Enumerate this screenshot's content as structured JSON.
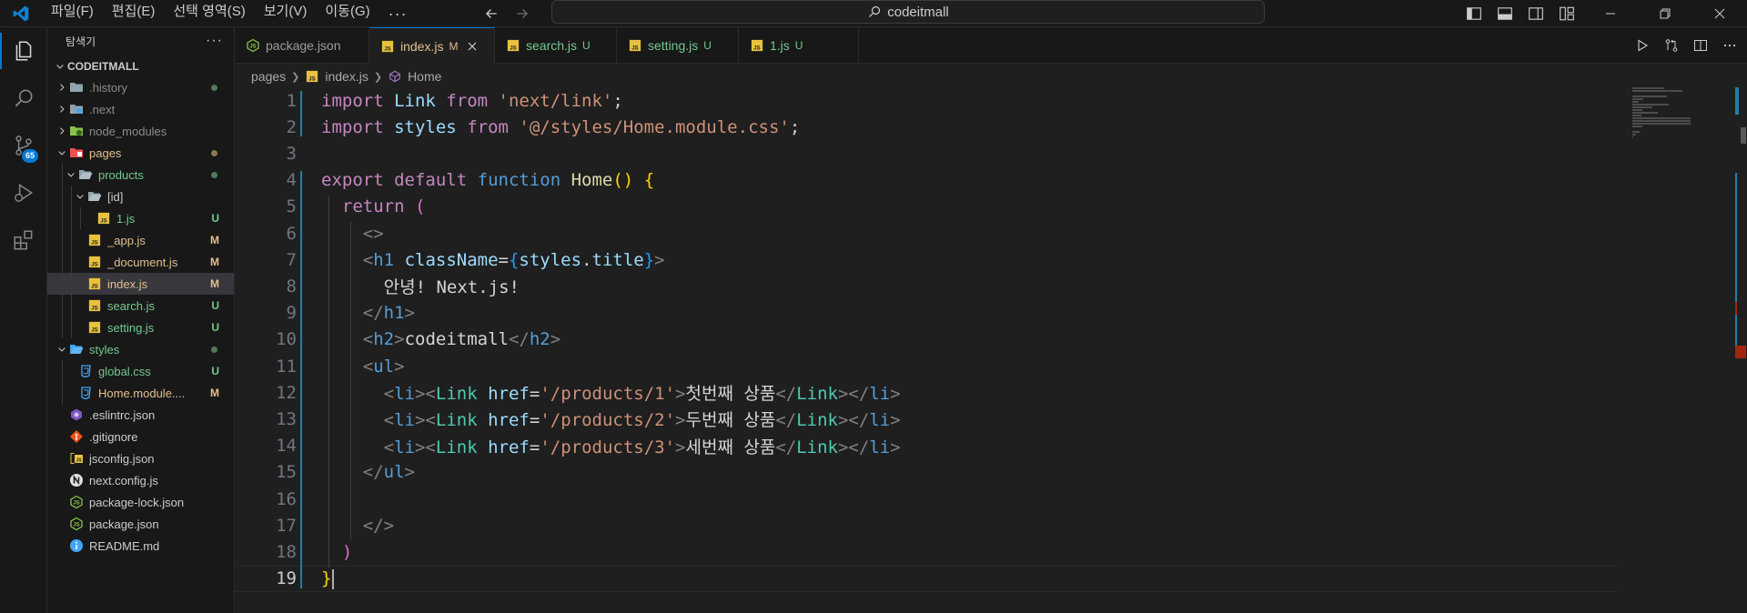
{
  "menubar": {
    "items": [
      "파일(F)",
      "편집(E)",
      "선택 영역(S)",
      "보기(V)",
      "이동(G)"
    ],
    "more": "···"
  },
  "command_center": {
    "label": "codeitmall"
  },
  "activitybar": {
    "items": [
      "explorer",
      "search",
      "source-control",
      "run-debug",
      "extensions"
    ],
    "scm_badge": "65"
  },
  "sidebar": {
    "title": "탐색기",
    "more": "···",
    "section": "CODEITMALL",
    "tree": [
      {
        "label": ".history",
        "depth": 0,
        "kind": "folder",
        "open": false,
        "color": "grey",
        "dot": "green"
      },
      {
        "label": ".next",
        "depth": 0,
        "kind": "folder-special",
        "open": false,
        "color": "grey",
        "dot": ""
      },
      {
        "label": "node_modules",
        "depth": 0,
        "kind": "folder-node",
        "open": false,
        "color": "grey",
        "dot": ""
      },
      {
        "label": "pages",
        "depth": 0,
        "kind": "folder-pages",
        "open": true,
        "color": "yellow",
        "dot": "yellow"
      },
      {
        "label": "products",
        "depth": 1,
        "kind": "folder-open",
        "open": true,
        "color": "green",
        "dot": "green"
      },
      {
        "label": "[id]",
        "depth": 2,
        "kind": "folder-open",
        "open": true,
        "color": "plain",
        "dot": ""
      },
      {
        "label": "1.js",
        "depth": 3,
        "kind": "js",
        "color": "green",
        "status": "U"
      },
      {
        "label": "_app.js",
        "depth": 2,
        "kind": "js",
        "color": "yellow",
        "status": "M"
      },
      {
        "label": "_document.js",
        "depth": 2,
        "kind": "js",
        "color": "yellow",
        "status": "M"
      },
      {
        "label": "index.js",
        "depth": 2,
        "kind": "js",
        "color": "yellow",
        "status": "M",
        "selected": true
      },
      {
        "label": "search.js",
        "depth": 2,
        "kind": "js",
        "color": "green",
        "status": "U"
      },
      {
        "label": "setting.js",
        "depth": 2,
        "kind": "js",
        "color": "green",
        "status": "U"
      },
      {
        "label": "styles",
        "depth": 0,
        "kind": "folder-open-blue",
        "open": true,
        "color": "green",
        "dot": "green"
      },
      {
        "label": "global.css",
        "depth": 1,
        "kind": "css",
        "color": "green",
        "status": "U"
      },
      {
        "label": "Home.module....",
        "depth": 1,
        "kind": "css",
        "color": "yellow",
        "status": "M"
      },
      {
        "label": ".eslintrc.json",
        "depth": 0,
        "kind": "eslint",
        "color": "plain"
      },
      {
        "label": ".gitignore",
        "depth": 0,
        "kind": "git",
        "color": "plain"
      },
      {
        "label": "jsconfig.json",
        "depth": 0,
        "kind": "jsconfig",
        "color": "plain"
      },
      {
        "label": "next.config.js",
        "depth": 0,
        "kind": "next",
        "color": "plain"
      },
      {
        "label": "package-lock.json",
        "depth": 0,
        "kind": "npm",
        "color": "plain"
      },
      {
        "label": "package.json",
        "depth": 0,
        "kind": "npm",
        "color": "plain"
      },
      {
        "label": "README.md",
        "depth": 0,
        "kind": "info",
        "color": "plain"
      }
    ]
  },
  "tabs": [
    {
      "label": "package.json",
      "icon": "npm",
      "status": "",
      "active": false
    },
    {
      "label": "index.js",
      "icon": "js",
      "status": "M",
      "active": true
    },
    {
      "label": "search.js",
      "icon": "js",
      "status": "U",
      "active": false
    },
    {
      "label": "setting.js",
      "icon": "js",
      "status": "U",
      "active": false
    },
    {
      "label": "1.js",
      "icon": "js",
      "status": "U",
      "active": false
    }
  ],
  "breadcrumb": [
    "pages",
    "index.js",
    "Home"
  ],
  "editor": {
    "active_line": 19,
    "lines": [
      [
        [
          "kw",
          "import"
        ],
        [
          "tx",
          " "
        ],
        [
          "vr",
          "Link"
        ],
        [
          "tx",
          " "
        ],
        [
          "kw",
          "from"
        ],
        [
          "tx",
          " "
        ],
        [
          "st",
          "'next/link'"
        ],
        [
          "tx",
          ";"
        ]
      ],
      [
        [
          "kw",
          "import"
        ],
        [
          "tx",
          " "
        ],
        [
          "vr",
          "styles"
        ],
        [
          "tx",
          " "
        ],
        [
          "kw",
          "from"
        ],
        [
          "tx",
          " "
        ],
        [
          "st",
          "'@/styles/Home.module.css'"
        ],
        [
          "tx",
          ";"
        ]
      ],
      [],
      [
        [
          "kw",
          "export"
        ],
        [
          "tx",
          " "
        ],
        [
          "kw",
          "default"
        ],
        [
          "tx",
          " "
        ],
        [
          "bl",
          "function"
        ],
        [
          "tx",
          " "
        ],
        [
          "fn",
          "Home"
        ],
        [
          "b1",
          "()"
        ],
        [
          "tx",
          " "
        ],
        [
          "b1",
          "{"
        ]
      ],
      [
        [
          "tx",
          "  "
        ],
        [
          "kw",
          "return"
        ],
        [
          "tx",
          " "
        ],
        [
          "b2",
          "("
        ]
      ],
      [
        [
          "tx",
          "    "
        ],
        [
          "pn",
          "<>"
        ]
      ],
      [
        [
          "tx",
          "    "
        ],
        [
          "pn",
          "<"
        ],
        [
          "tg",
          "h1"
        ],
        [
          "tx",
          " "
        ],
        [
          "at",
          "className"
        ],
        [
          "tx",
          "="
        ],
        [
          "b3",
          "{"
        ],
        [
          "vr",
          "styles"
        ],
        [
          "tx",
          "."
        ],
        [
          "vr",
          "title"
        ],
        [
          "b3",
          "}"
        ],
        [
          "pn",
          ">"
        ]
      ],
      [
        [
          "tx",
          "      안녕! Next.js!"
        ]
      ],
      [
        [
          "tx",
          "    "
        ],
        [
          "pn",
          "</"
        ],
        [
          "tg",
          "h1"
        ],
        [
          "pn",
          ">"
        ]
      ],
      [
        [
          "tx",
          "    "
        ],
        [
          "pn",
          "<"
        ],
        [
          "tg",
          "h2"
        ],
        [
          "pn",
          ">"
        ],
        [
          "tx",
          "codeitmall"
        ],
        [
          "pn",
          "</"
        ],
        [
          "tg",
          "h2"
        ],
        [
          "pn",
          ">"
        ]
      ],
      [
        [
          "tx",
          "    "
        ],
        [
          "pn",
          "<"
        ],
        [
          "tg",
          "ul"
        ],
        [
          "pn",
          ">"
        ]
      ],
      [
        [
          "tx",
          "      "
        ],
        [
          "pn",
          "<"
        ],
        [
          "tg",
          "li"
        ],
        [
          "pn",
          "><"
        ],
        [
          "cp",
          "Link"
        ],
        [
          "tx",
          " "
        ],
        [
          "at",
          "href"
        ],
        [
          "tx",
          "="
        ],
        [
          "st",
          "'/products/1'"
        ],
        [
          "pn",
          ">"
        ],
        [
          "tx",
          "첫번째 상품"
        ],
        [
          "pn",
          "</"
        ],
        [
          "cp",
          "Link"
        ],
        [
          "pn",
          "></"
        ],
        [
          "tg",
          "li"
        ],
        [
          "pn",
          ">"
        ]
      ],
      [
        [
          "tx",
          "      "
        ],
        [
          "pn",
          "<"
        ],
        [
          "tg",
          "li"
        ],
        [
          "pn",
          "><"
        ],
        [
          "cp",
          "Link"
        ],
        [
          "tx",
          " "
        ],
        [
          "at",
          "href"
        ],
        [
          "tx",
          "="
        ],
        [
          "st",
          "'/products/2'"
        ],
        [
          "pn",
          ">"
        ],
        [
          "tx",
          "두번째 상품"
        ],
        [
          "pn",
          "</"
        ],
        [
          "cp",
          "Link"
        ],
        [
          "pn",
          "></"
        ],
        [
          "tg",
          "li"
        ],
        [
          "pn",
          ">"
        ]
      ],
      [
        [
          "tx",
          "      "
        ],
        [
          "pn",
          "<"
        ],
        [
          "tg",
          "li"
        ],
        [
          "pn",
          "><"
        ],
        [
          "cp",
          "Link"
        ],
        [
          "tx",
          " "
        ],
        [
          "at",
          "href"
        ],
        [
          "tx",
          "="
        ],
        [
          "st",
          "'/products/3'"
        ],
        [
          "pn",
          ">"
        ],
        [
          "tx",
          "세번째 상품"
        ],
        [
          "pn",
          "</"
        ],
        [
          "cp",
          "Link"
        ],
        [
          "pn",
          "></"
        ],
        [
          "tg",
          "li"
        ],
        [
          "pn",
          ">"
        ]
      ],
      [
        [
          "tx",
          "    "
        ],
        [
          "pn",
          "</"
        ],
        [
          "tg",
          "ul"
        ],
        [
          "pn",
          ">"
        ]
      ],
      [],
      [
        [
          "tx",
          "    "
        ],
        [
          "pn",
          "</>"
        ]
      ],
      [
        [
          "tx",
          "  "
        ],
        [
          "b2",
          ")"
        ]
      ],
      [
        [
          "b1",
          "}"
        ]
      ]
    ]
  },
  "colors": {
    "accent": "#0078d4",
    "modified": "#e2c08d",
    "untracked": "#73c991"
  }
}
